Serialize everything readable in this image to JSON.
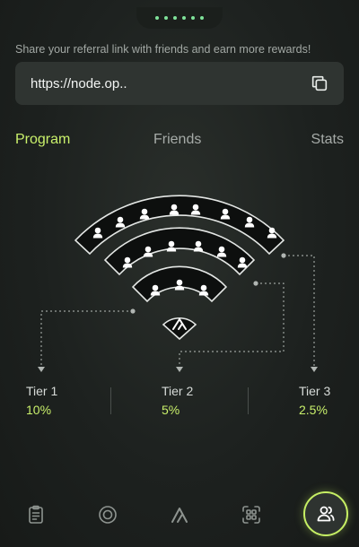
{
  "header": {
    "share_text": "Share your referral link with friends and earn more rewards!"
  },
  "referral": {
    "link": "https://node.op.."
  },
  "tabs": [
    {
      "label": "Program",
      "active": true
    },
    {
      "label": "Friends",
      "active": false
    },
    {
      "label": "Stats",
      "active": false
    }
  ],
  "tiers": [
    {
      "name": "Tier 1",
      "percent": "10%"
    },
    {
      "name": "Tier 2",
      "percent": "5%"
    },
    {
      "name": "Tier 3",
      "percent": "2.5%"
    }
  ],
  "nav": [
    {
      "icon": "clipboard-icon",
      "active": false
    },
    {
      "icon": "target-icon",
      "active": false
    },
    {
      "icon": "logo-icon",
      "active": false
    },
    {
      "icon": "scan-icon",
      "active": false
    },
    {
      "icon": "users-icon",
      "active": true
    }
  ],
  "colors": {
    "accent": "#c9f06b",
    "background": "#1d211f",
    "panel": "#2f3431"
  }
}
